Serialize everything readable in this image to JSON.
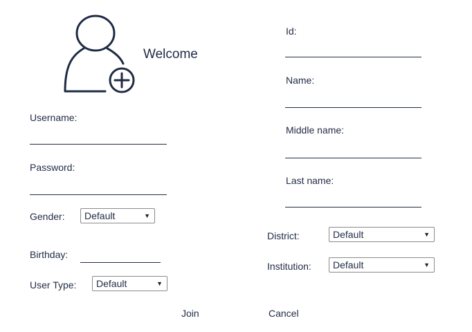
{
  "header": {
    "welcome": "Welcome"
  },
  "left": {
    "username_label": "Username:",
    "password_label": "Password:",
    "gender_label": "Gender:",
    "gender_value": "Default",
    "birthday_label": "Birthday:",
    "user_type_label": "User Type:",
    "user_type_value": "Default"
  },
  "right": {
    "id_label": "Id:",
    "name_label": "Name:",
    "middle_name_label": "Middle name:",
    "last_name_label": "Last name:",
    "district_label": "District:",
    "district_value": "Default",
    "institution_label": "Institution:",
    "institution_value": "Default"
  },
  "actions": {
    "join_label": "Join",
    "cancel_label": "Cancel"
  },
  "icons": {
    "avatar": "add-user-icon"
  },
  "colors": {
    "text": "#1f2a44",
    "icon": "#1f2a44"
  }
}
